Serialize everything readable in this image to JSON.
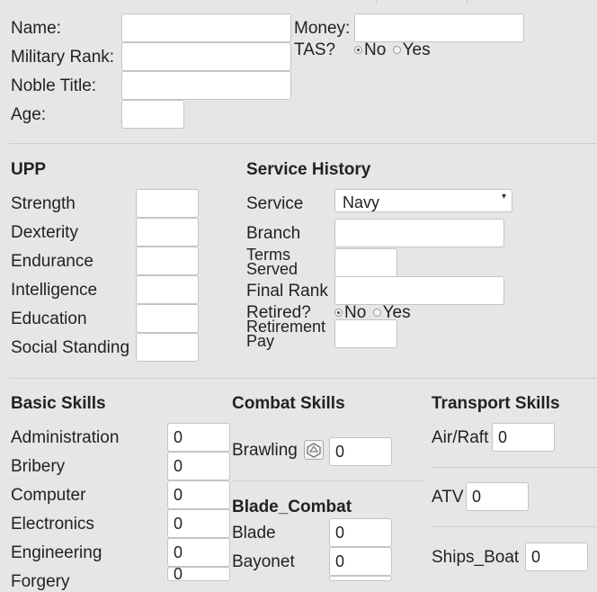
{
  "top_right_tab": "",
  "character": {
    "name_label": "Name:",
    "name_value": "",
    "rank_label": "Military Rank:",
    "rank_value": "",
    "noble_label": "Noble Title:",
    "noble_value": "",
    "age_label": "Age:",
    "age_value": "",
    "money_label": "Money:",
    "money_value": "",
    "tas_label": "TAS?",
    "tas_no": "No",
    "tas_yes": "Yes",
    "tas_selected": "No"
  },
  "upp": {
    "title": "UPP",
    "stats": [
      {
        "label": "Strength",
        "value": ""
      },
      {
        "label": "Dexterity",
        "value": ""
      },
      {
        "label": "Endurance",
        "value": ""
      },
      {
        "label": "Intelligence",
        "value": ""
      },
      {
        "label": "Education",
        "value": ""
      },
      {
        "label": "Social Standing",
        "value": ""
      }
    ]
  },
  "service": {
    "title": "Service History",
    "service_label": "Service",
    "service_value": "Navy",
    "branch_label": "Branch",
    "branch_value": "",
    "terms_label_1": "Terms",
    "terms_label_2": "Served",
    "terms_value": "",
    "final_rank_label": "Final Rank",
    "final_rank_value": "",
    "retired_label": "Retired?",
    "retired_no": "No",
    "retired_yes": "Yes",
    "retired_selected": "No",
    "pay_label_1": "Retirement",
    "pay_label_2": "Pay",
    "pay_value": ""
  },
  "basic_skills": {
    "title": "Basic Skills",
    "items": [
      {
        "label": "Administration",
        "value": "0"
      },
      {
        "label": "Bribery",
        "value": "0"
      },
      {
        "label": "Computer",
        "value": "0"
      },
      {
        "label": "Electronics",
        "value": "0"
      },
      {
        "label": "Engineering",
        "value": "0"
      },
      {
        "label": "Forgery",
        "value": "0"
      }
    ]
  },
  "combat_skills": {
    "title": "Combat Skills",
    "brawling_label": "Brawling",
    "brawling_value": "0",
    "dice_icon": "dice-icon",
    "blade_title": "Blade_Combat",
    "blade_label": "Blade",
    "blade_value": "0",
    "bayonet_label": "Bayonet",
    "bayonet_value": "0"
  },
  "transport_skills": {
    "title": "Transport Skills",
    "airraft_label": "Air/Raft",
    "airraft_value": "0",
    "atv_label": "ATV",
    "atv_value": "0",
    "boat_label": "Ships_Boat",
    "boat_value": "0"
  }
}
